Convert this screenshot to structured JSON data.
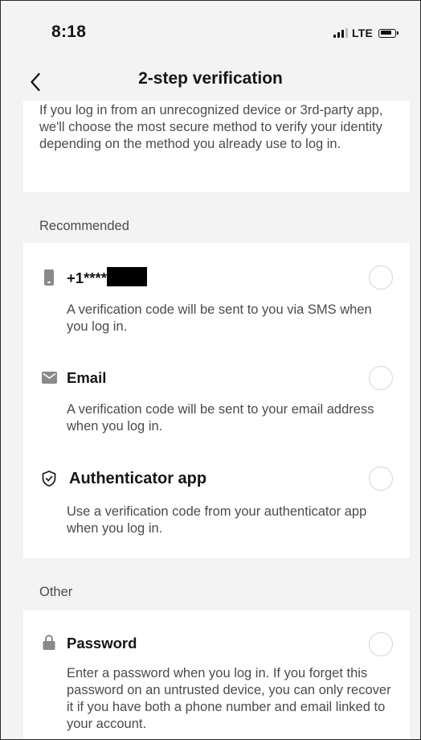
{
  "status_bar": {
    "time": "8:18",
    "network": "LTE"
  },
  "header": {
    "title": "2-step verification",
    "back_icon": "chevron-left-icon"
  },
  "intro": {
    "text": "If you log in from an unrecognized device or 3rd-party app, we'll choose the most secure method to verify your identity depending on the method you already use to log in."
  },
  "sections": {
    "recommended_label": "Recommended",
    "other_label": "Other"
  },
  "options": {
    "phone": {
      "icon": "phone-icon",
      "title": "+1****",
      "description": "A verification code will be sent to you via SMS when you log in.",
      "selected": false
    },
    "email": {
      "icon": "mail-icon",
      "title": "Email",
      "description": "A verification code will be sent to your email address when you log in.",
      "selected": false
    },
    "authenticator": {
      "icon": "shield-check-icon",
      "title": "Authenticator app",
      "description": "Use a verification code from your authenticator app when you log in.",
      "selected": false
    },
    "password": {
      "icon": "lock-icon",
      "title": "Password",
      "description": "Enter a password when you log in. If you forget this password on an untrusted device, you can only recover it if you have both a phone number and email linked to your account.",
      "selected": false
    }
  },
  "colors": {
    "background": "#f3f3f3",
    "card": "#ffffff",
    "text_primary": "#161616",
    "text_secondary": "#4b4b4b",
    "radio_border": "#d6d6d6",
    "icon_gray": "#8a8a8a"
  }
}
